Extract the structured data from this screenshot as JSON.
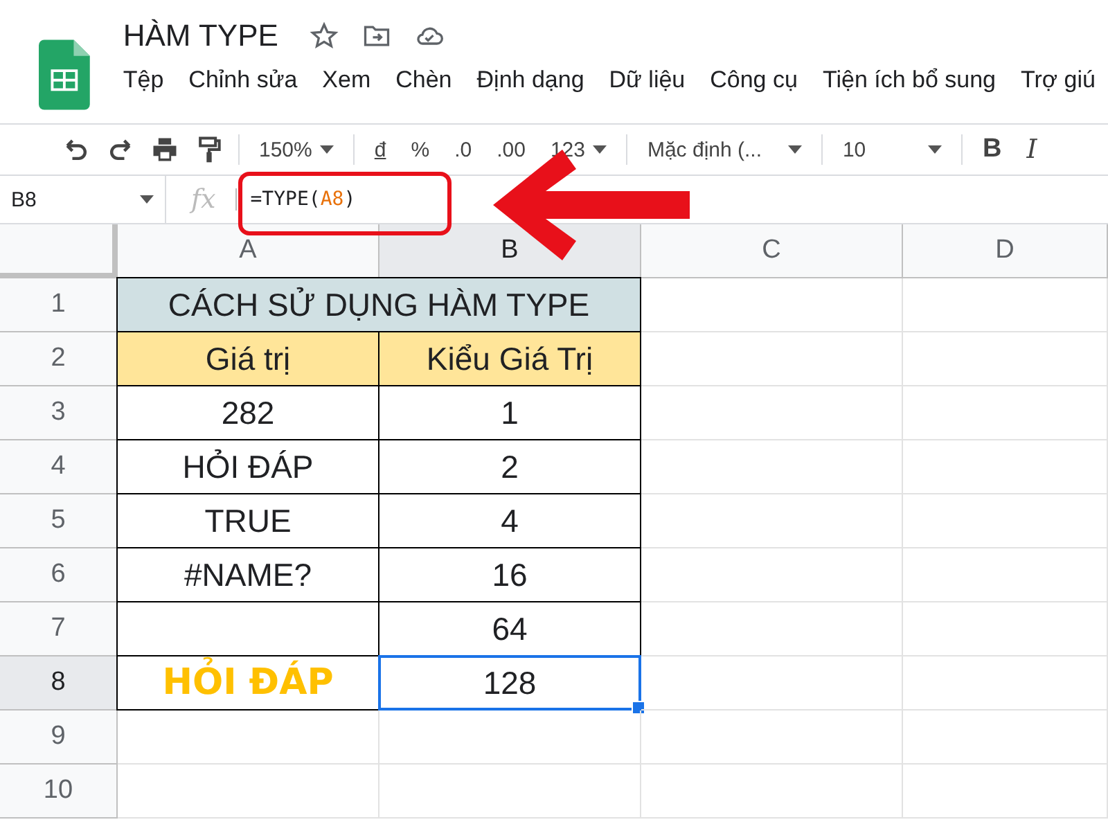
{
  "app": {
    "title": "HÀM TYPE",
    "menu": [
      "Tệp",
      "Chỉnh sửa",
      "Xem",
      "Chèn",
      "Định dạng",
      "Dữ liệu",
      "Công cụ",
      "Tiện ích bổ sung",
      "Trợ giú"
    ]
  },
  "toolbar": {
    "zoom": "150%",
    "currency": "đ",
    "percent": "%",
    "decrease_decimals": ".0",
    "increase_decimals": ".00",
    "number_format": "123",
    "font": "Mặc định (...",
    "font_size": "10",
    "bold": "B",
    "italic": "I"
  },
  "formula_bar": {
    "cell": "B8",
    "fx": "fx",
    "formula": [
      {
        "text": "=TYPE(",
        "kind": "plain"
      },
      {
        "text": "A8",
        "kind": "ref"
      },
      {
        "text": ")",
        "kind": "plain"
      }
    ]
  },
  "columns": [
    {
      "label": "A",
      "selected": false
    },
    {
      "label": "B",
      "selected": true
    },
    {
      "label": "C",
      "selected": false
    },
    {
      "label": "D",
      "selected": false
    }
  ],
  "rows": [
    {
      "label": "1",
      "selected": false,
      "cells": [
        {
          "text": "CÁCH SỬ DỤNG HÀM TYPE",
          "kind": "title",
          "selected": false
        }
      ]
    },
    {
      "label": "2",
      "selected": false,
      "cells": [
        {
          "text": "Giá trị",
          "kind": "header",
          "selected": false
        },
        {
          "text": "Kiểu Giá Trị",
          "kind": "header",
          "selected": false
        }
      ]
    },
    {
      "label": "3",
      "selected": false,
      "cells": [
        {
          "text": "282",
          "kind": "value",
          "selected": false
        },
        {
          "text": "1",
          "kind": "value",
          "selected": false
        }
      ]
    },
    {
      "label": "4",
      "selected": false,
      "cells": [
        {
          "text": "HỎI ĐÁP",
          "kind": "value",
          "selected": false
        },
        {
          "text": "2",
          "kind": "value",
          "selected": false
        }
      ]
    },
    {
      "label": "5",
      "selected": false,
      "cells": [
        {
          "text": "TRUE",
          "kind": "value",
          "selected": false
        },
        {
          "text": "4",
          "kind": "value",
          "selected": false
        }
      ]
    },
    {
      "label": "6",
      "selected": false,
      "cells": [
        {
          "text": "#NAME?",
          "kind": "value",
          "selected": false
        },
        {
          "text": "16",
          "kind": "value",
          "selected": false
        }
      ]
    },
    {
      "label": "7",
      "selected": false,
      "cells": [
        {
          "text": "",
          "kind": "blank",
          "selected": false
        },
        {
          "text": "64",
          "kind": "value",
          "selected": false
        }
      ]
    },
    {
      "label": "8",
      "selected": true,
      "cells": [
        {
          "text": "HỎI ĐÁP",
          "kind": "logo",
          "selected": false
        },
        {
          "text": "128",
          "kind": "value",
          "selected": true
        }
      ]
    },
    {
      "label": "9",
      "selected": false
    },
    {
      "label": "10",
      "selected": false
    }
  ]
}
